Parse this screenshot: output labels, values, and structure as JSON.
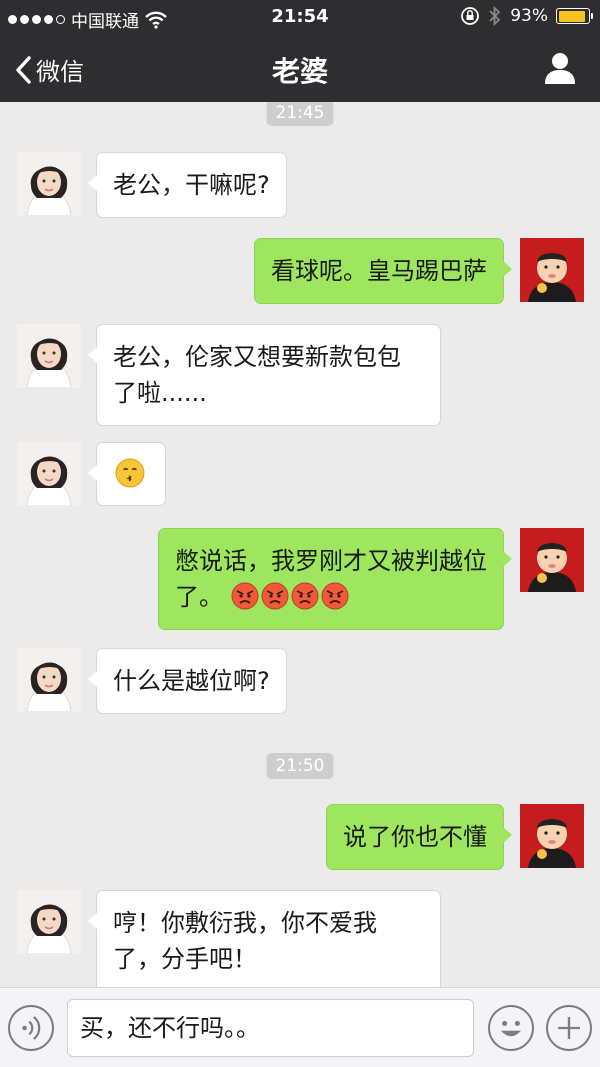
{
  "status_bar": {
    "carrier": "中国联通",
    "time": "21:54",
    "battery": "93%",
    "battery_level": 0.93,
    "signal_icon": "signal-dots-icon",
    "wifi_icon": "wifi-icon",
    "lock_icon": "orientation-lock-icon",
    "bluetooth_icon": "bluetooth-icon",
    "battery_color": "#f7c21b"
  },
  "nav": {
    "back_label": "微信",
    "title": "老婆",
    "profile_icon": "person-icon"
  },
  "chat": {
    "timestamps": [
      "21:45",
      "21:50"
    ],
    "messages": [
      {
        "sender": "wife",
        "text": "老公，干嘛呢?"
      },
      {
        "sender": "me",
        "text": "看球呢。皇马踢巴萨"
      },
      {
        "sender": "wife",
        "text": "老公，伦家又想要新款包包了啦......"
      },
      {
        "sender": "wife",
        "text": "",
        "emoji": "kiss-emoji-icon"
      },
      {
        "sender": "me",
        "text": "憋说话，我罗刚才又被判越位了。",
        "emoji": "angry-face-emoji-icon",
        "emoji_count": 4
      },
      {
        "sender": "wife",
        "text": "什么是越位啊?"
      },
      {
        "sender": "me",
        "text": "说了你也不懂"
      },
      {
        "sender": "wife",
        "text": "哼！你敷衍我，你不爱我了，分手吧！"
      }
    ]
  },
  "input_bar": {
    "voice_icon": "voice-icon",
    "text": "买，还不行吗。。",
    "emoji_icon": "smiley-icon",
    "plus_icon": "plus-icon"
  },
  "colors": {
    "nav_bg": "#2e2e30",
    "chat_bg": "#ebebeb",
    "my_bubble": "#9ee65e",
    "their_bubble": "#ffffff"
  }
}
